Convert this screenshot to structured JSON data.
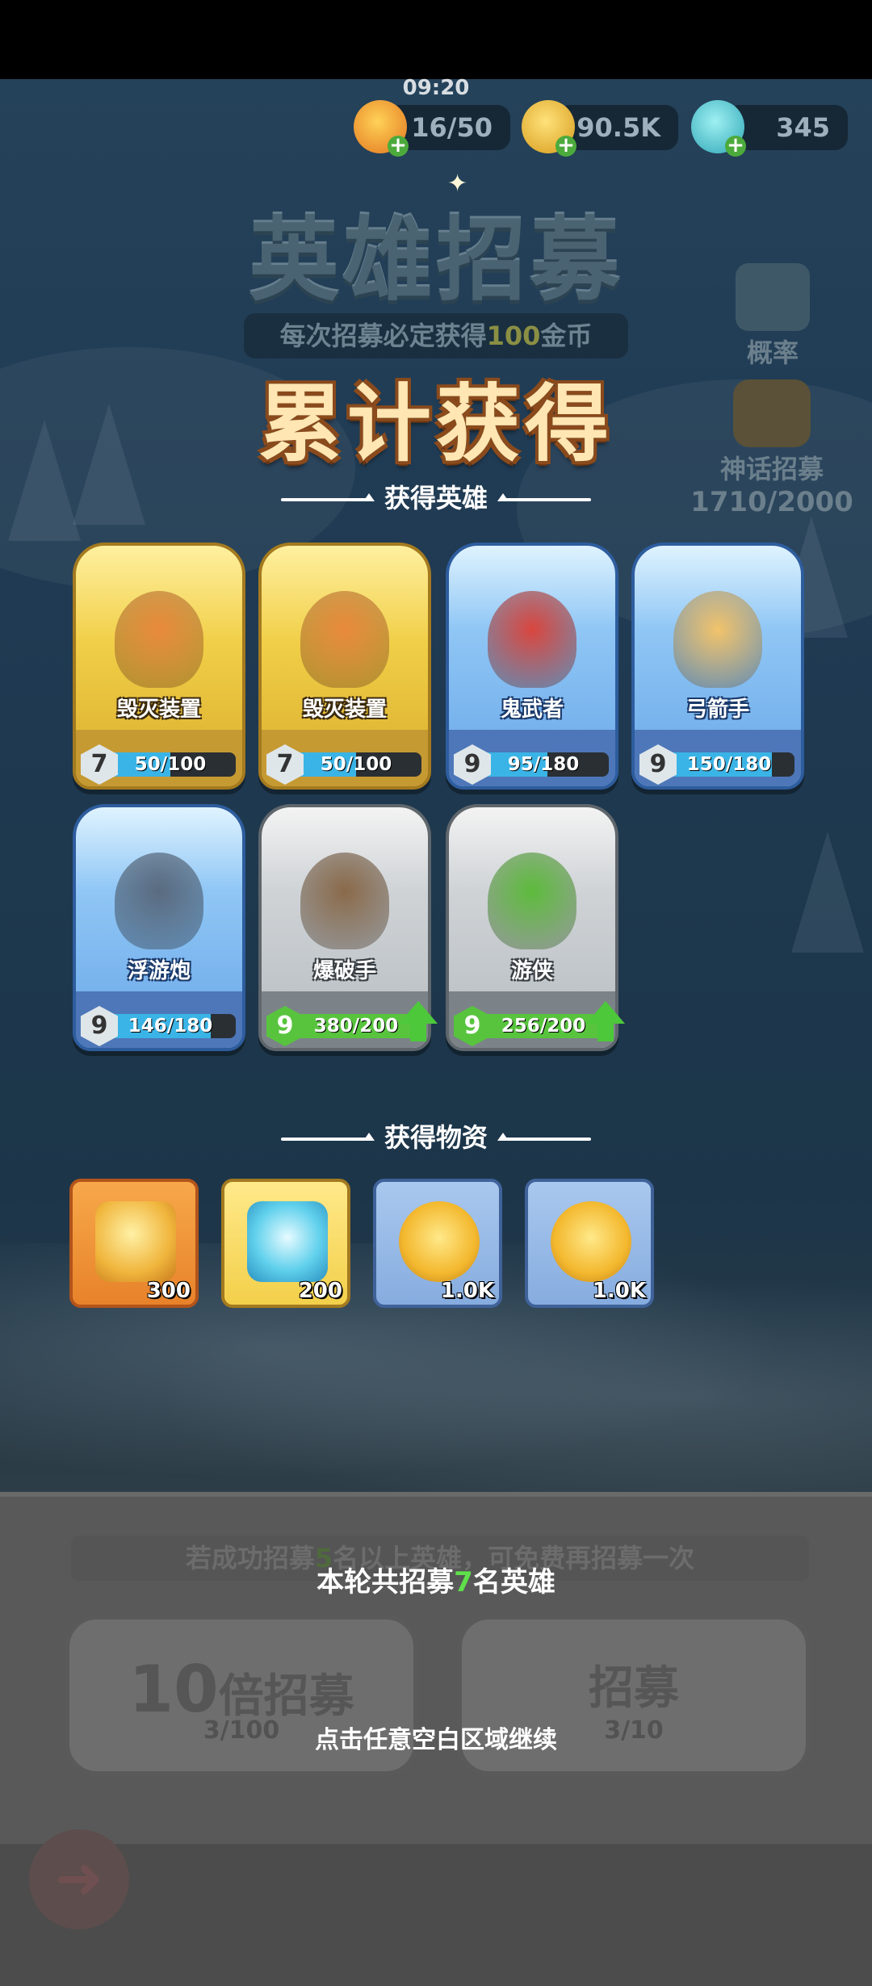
{
  "status": {
    "time": "09:20"
  },
  "resources": {
    "energy": {
      "value": "16/50",
      "icon": "flame-energy-icon"
    },
    "coins": {
      "value": "90.5K",
      "icon": "gold-coin-icon"
    },
    "crystals": {
      "value": "345",
      "icon": "snow-crystal-icon"
    }
  },
  "banner": {
    "title": "英雄招募",
    "subtitle_pre": "每次招募必定获得",
    "subtitle_num": "100",
    "subtitle_post": "金币"
  },
  "side": {
    "rate_label": "概率",
    "mythic_label": "神话招募",
    "mythic_progress": "1710/2000"
  },
  "result": {
    "heading": "累计获得",
    "heroes_label": "获得英雄",
    "items_label": "获得物资"
  },
  "heroes": [
    {
      "name": "毁灭装置",
      "level": "7",
      "progress": "50/100",
      "fill": 0.5,
      "rarity": "gold",
      "upgrade": false
    },
    {
      "name": "毁灭装置",
      "level": "7",
      "progress": "50/100",
      "fill": 0.5,
      "rarity": "gold",
      "upgrade": false
    },
    {
      "name": "鬼武者",
      "level": "9",
      "progress": "95/180",
      "fill": 0.53,
      "rarity": "blue",
      "upgrade": false
    },
    {
      "name": "弓箭手",
      "level": "9",
      "progress": "150/180",
      "fill": 0.83,
      "rarity": "blue",
      "upgrade": false
    },
    {
      "name": "浮游炮",
      "level": "9",
      "progress": "146/180",
      "fill": 0.81,
      "rarity": "blue",
      "upgrade": false
    },
    {
      "name": "爆破手",
      "level": "9",
      "progress": "380/200",
      "fill": 1.0,
      "rarity": "gray",
      "upgrade": true
    },
    {
      "name": "游侠",
      "level": "9",
      "progress": "256/200",
      "fill": 1.0,
      "rarity": "gray",
      "upgrade": true
    }
  ],
  "items": [
    {
      "icon": "gold-crystal-icon",
      "qty": "300",
      "style": "orange"
    },
    {
      "icon": "blue-crystal-icon",
      "qty": "200",
      "style": "yellow"
    },
    {
      "icon": "gold-coin-icon",
      "qty": "1.0K",
      "style": "blue"
    },
    {
      "icon": "gold-coin-icon",
      "qty": "1.0K",
      "style": "blue"
    }
  ],
  "bottom": {
    "note_pre": "若成功招募",
    "note_num": "5",
    "note_post": "名以上英雄，可免费再招募一次",
    "ten_label_num": "10",
    "ten_label": "倍招募",
    "ten_cost": "3/100",
    "one_label": "招募",
    "one_cost": "3/10"
  },
  "overlay": {
    "summary_pre": "本轮共招募",
    "summary_num": "7",
    "summary_post": "名英雄",
    "continue_hint": "点击任意空白区域继续"
  }
}
